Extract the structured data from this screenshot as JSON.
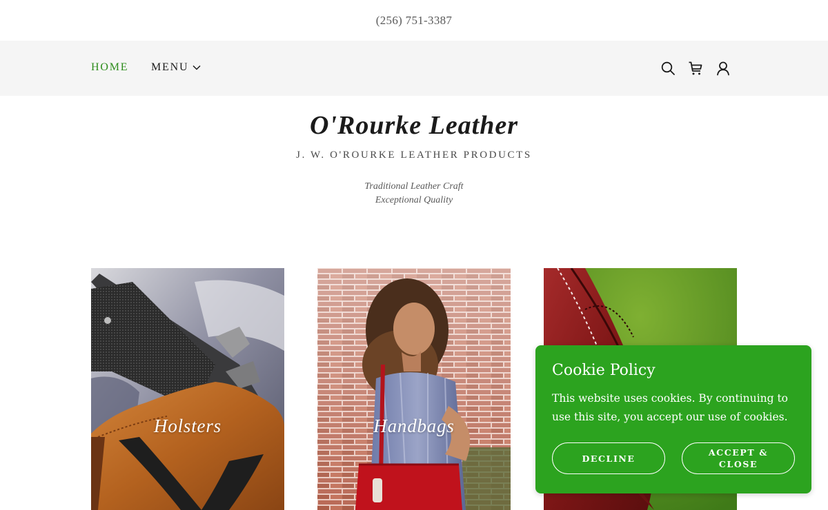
{
  "topbar": {
    "phone": "(256) 751-3387"
  },
  "nav": {
    "home_label": "HOME",
    "menu_label": "MENU",
    "icons": [
      "search-icon",
      "cart-icon",
      "account-icon"
    ],
    "accent_color": "#2c8c1b"
  },
  "header": {
    "title": "O'Rourke Leather",
    "tagline": "J. W. O'ROURKE LEATHER PRODUCTS",
    "description_line1": "Traditional Leather Craft",
    "description_line2": "Exceptional Quality"
  },
  "categories": [
    {
      "label": "Holsters"
    },
    {
      "label": "Handbags"
    },
    {
      "label": ""
    }
  ],
  "cookie": {
    "title": "Cookie Policy",
    "text": "This website uses cookies. By continuing to use this site, you accept our use of cookies.",
    "decline_label": "DECLINE",
    "accept_label": "ACCEPT & CLOSE",
    "background_color": "#2ca31f"
  }
}
